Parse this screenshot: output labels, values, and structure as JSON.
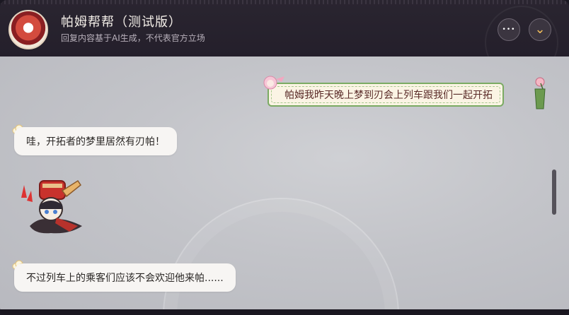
{
  "header": {
    "title": "帕姆帮帮（测试版）",
    "subtitle": "回复内容基于AI生成，不代表官方立场",
    "more_glyph": "•••",
    "collapse_glyph": "⌄"
  },
  "messages": {
    "user_1": "帕姆我昨天晚上梦到刃会上列车跟我们一起开拓",
    "bot_1": "哇，开拓者的梦里居然有刃帕！",
    "bot_2": "不过列车上的乘客们应该不会欢迎他来帕......"
  },
  "colors": {
    "header_bg": "#241f2b",
    "chat_bg": "#c3c4c9",
    "user_bubble_bg": "#fbf4e4",
    "user_bubble_border": "#7bab63",
    "bot_bubble_bg": "#f7f5f3",
    "accent": "#f5c05a"
  },
  "icons": {
    "avatar": "pom-pom-avatar",
    "more": "more-icon",
    "collapse": "chevron-down-icon",
    "bot_marker": "cloud-icon",
    "sticker": "pom-pom-sticker"
  }
}
